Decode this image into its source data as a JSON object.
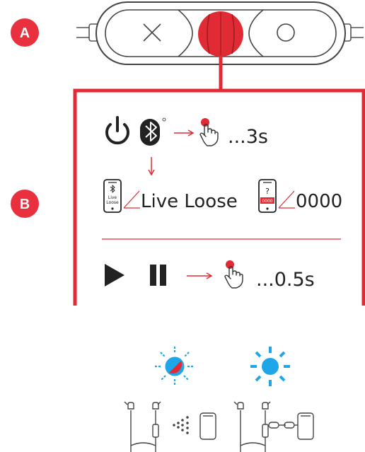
{
  "badges": {
    "a": "A",
    "b": "B"
  },
  "step1": {
    "duration": "...3s"
  },
  "pairing": {
    "device_name": "Live Loose",
    "phone_label": "Live\nLoose",
    "pin": "0000",
    "pin_icon_question": "?",
    "pin_icon_code": "0000"
  },
  "step2": {
    "duration": "...0.5s"
  },
  "colors": {
    "accent": "#e02b35",
    "badge": "#e8303e",
    "blue": "#1fa6e8",
    "dark": "#333333",
    "line": "#555555"
  },
  "icons": {
    "remote_left": "x-icon",
    "remote_right": "circle-icon",
    "power": "power-icon",
    "bluetooth": "bluetooth-icon",
    "hand": "hand-press-icon",
    "play": "play-icon",
    "pause": "pause-icon",
    "light_multi": "red-blue-flashing-light-icon",
    "light_blue": "blue-light-icon",
    "pairing_mode": "pairing-mode-illustration",
    "connected": "connected-illustration"
  }
}
